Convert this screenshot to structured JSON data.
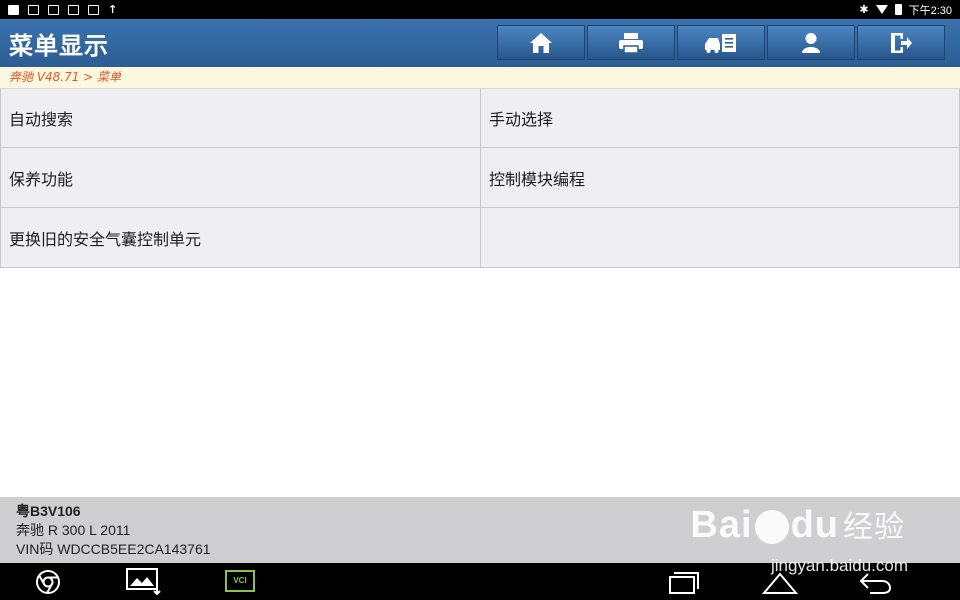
{
  "status_bar": {
    "time": "下午2:30"
  },
  "title": "菜单显示",
  "toolbar": {
    "buttons": [
      {
        "name": "home",
        "icon": "home-icon"
      },
      {
        "name": "print",
        "icon": "printer-icon"
      },
      {
        "name": "car-document",
        "icon": "car-document-icon"
      },
      {
        "name": "user",
        "icon": "user-icon"
      },
      {
        "name": "exit",
        "icon": "exit-icon"
      }
    ]
  },
  "breadcrumb": "奔驰 V48.71 > 菜单",
  "menu": {
    "items": [
      "自动搜索",
      "手动选择",
      "保养功能",
      "控制模块编程",
      "更换旧的安全气囊控制单元",
      ""
    ]
  },
  "vehicle": {
    "plate": "粤B3V106",
    "model": "奔驰 R 300 L 2011",
    "vin": "VIN码 WDCCB5EE2CA143761"
  },
  "watermark": {
    "brand_left": "Bai",
    "brand_right": "du",
    "brand_cn": "经验",
    "url": "jingyan.baidu.com"
  },
  "nav_bar": {
    "vci_label": "VCI"
  },
  "colors": {
    "titlebar": "#2c5d93",
    "breadcrumb_text": "#e0582a",
    "breadcrumb_bg": "#fcf7df"
  }
}
